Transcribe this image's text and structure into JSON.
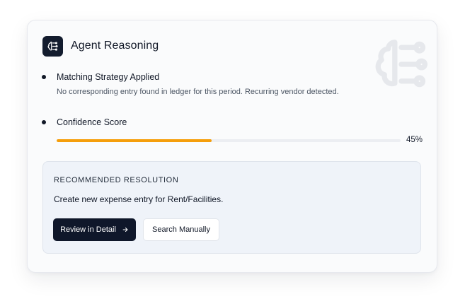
{
  "panel": {
    "title": "Agent Reasoning",
    "icon": "brain-icon"
  },
  "items": [
    {
      "title": "Matching Strategy Applied",
      "description": "No corresponding entry found in ledger for this period. Recurring vendor detected."
    },
    {
      "title": "Confidence Score"
    }
  ],
  "confidence": {
    "percent": 45,
    "label": "45%",
    "color": "#f59e0b"
  },
  "resolution": {
    "heading": "RECOMMENDED RESOLUTION",
    "text": "Create new expense entry for Rent/Facilities.",
    "primary_button": "Review in Detail",
    "primary_button_icon": "arrow-right-icon",
    "secondary_button": "Search Manually"
  },
  "colors": {
    "primary": "#0f172a",
    "accent": "#f59e0b"
  }
}
